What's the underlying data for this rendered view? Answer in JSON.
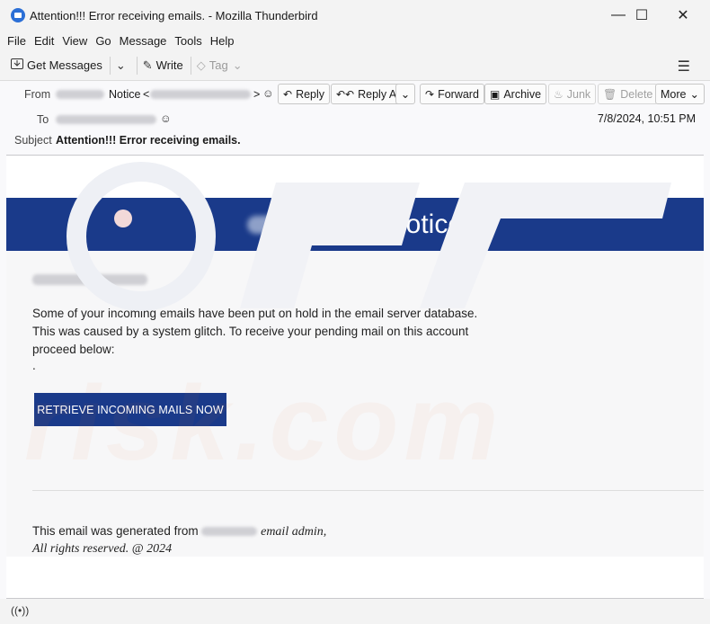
{
  "window": {
    "title": "Attention!!! Error receiving emails. - Mozilla Thunderbird",
    "minimize_icon": "—",
    "maximize_icon": "☐",
    "close_icon": "✕"
  },
  "menu": [
    "File",
    "Edit",
    "View",
    "Go",
    "Message",
    "Tools",
    "Help"
  ],
  "toolbar": {
    "get_messages": "Get Messages",
    "write": "Write",
    "tag": "Tag"
  },
  "header": {
    "from_label": "From",
    "from_name": "Notice",
    "to_label": "To",
    "subject_label": "Subject",
    "subject": "Attention!!! Error receiving emails.",
    "date": "7/8/2024, 10:51 PM",
    "buttons": {
      "reply": "Reply",
      "reply_all": "Reply All",
      "forward": "Forward",
      "archive": "Archive",
      "junk": "Junk",
      "delete": "Delete",
      "more": "More"
    }
  },
  "message": {
    "banner_title": "notice",
    "para_lines": [
      "Some of your incoming emails have been put on hold in the email server database.",
      "This was caused by a system glitch. To receive your pending mail on this account",
      "proceed below:",
      "."
    ],
    "cta": "RETRIEVE INCOMING MAILS NOW",
    "footer_prefix": "This email was generated from",
    "footer_suffix": "email admin,",
    "footer_line2": "All rights reserved. @ 2024"
  },
  "watermark": {
    "text": "risk.com"
  },
  "colors": {
    "banner": "#1a3a8a",
    "button": "#1a3a8a",
    "window_chrome": "#f3f3f3"
  }
}
